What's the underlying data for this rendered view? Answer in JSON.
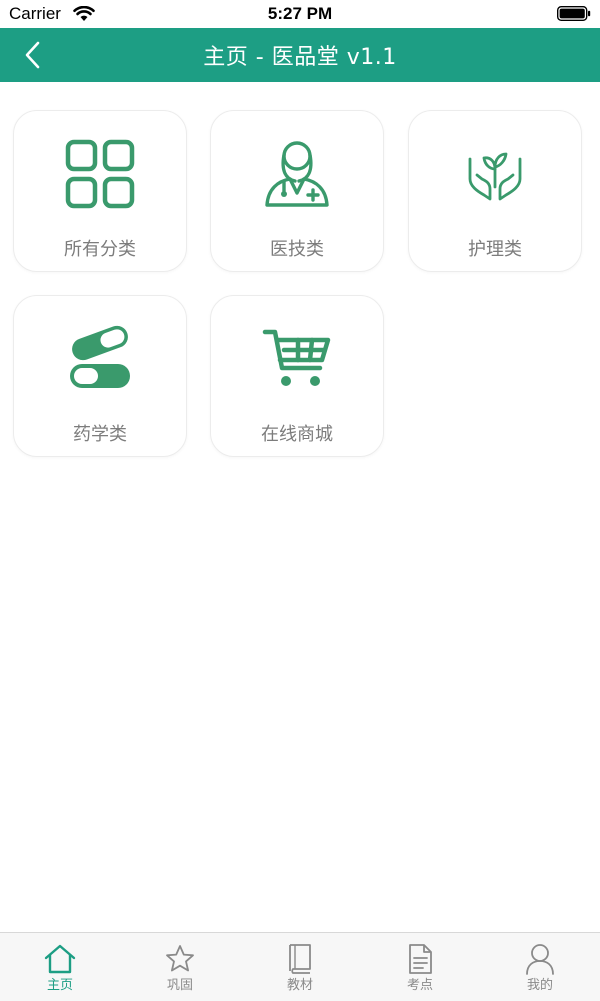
{
  "status_bar": {
    "carrier": "Carrier",
    "time": "5:27 PM"
  },
  "nav": {
    "title": "主页 - 医品堂 v1.1"
  },
  "categories": [
    {
      "label": "所有分类",
      "icon": "grid-icon"
    },
    {
      "label": "医技类",
      "icon": "doctor-icon"
    },
    {
      "label": "护理类",
      "icon": "care-hands-icon"
    },
    {
      "label": "药学类",
      "icon": "pills-icon"
    },
    {
      "label": "在线商城",
      "icon": "cart-icon"
    }
  ],
  "tabs": [
    {
      "label": "主页",
      "icon": "home-icon",
      "active": true
    },
    {
      "label": "巩固",
      "icon": "star-icon",
      "active": false
    },
    {
      "label": "教材",
      "icon": "book-icon",
      "active": false
    },
    {
      "label": "考点",
      "icon": "document-icon",
      "active": false
    },
    {
      "label": "我的",
      "icon": "person-icon",
      "active": false
    }
  ],
  "colors": {
    "brand": "#1d9e84",
    "icon_green": "#3a9a6c",
    "label_gray": "#7c7c7c",
    "tab_inactive": "#8a8a8a"
  }
}
